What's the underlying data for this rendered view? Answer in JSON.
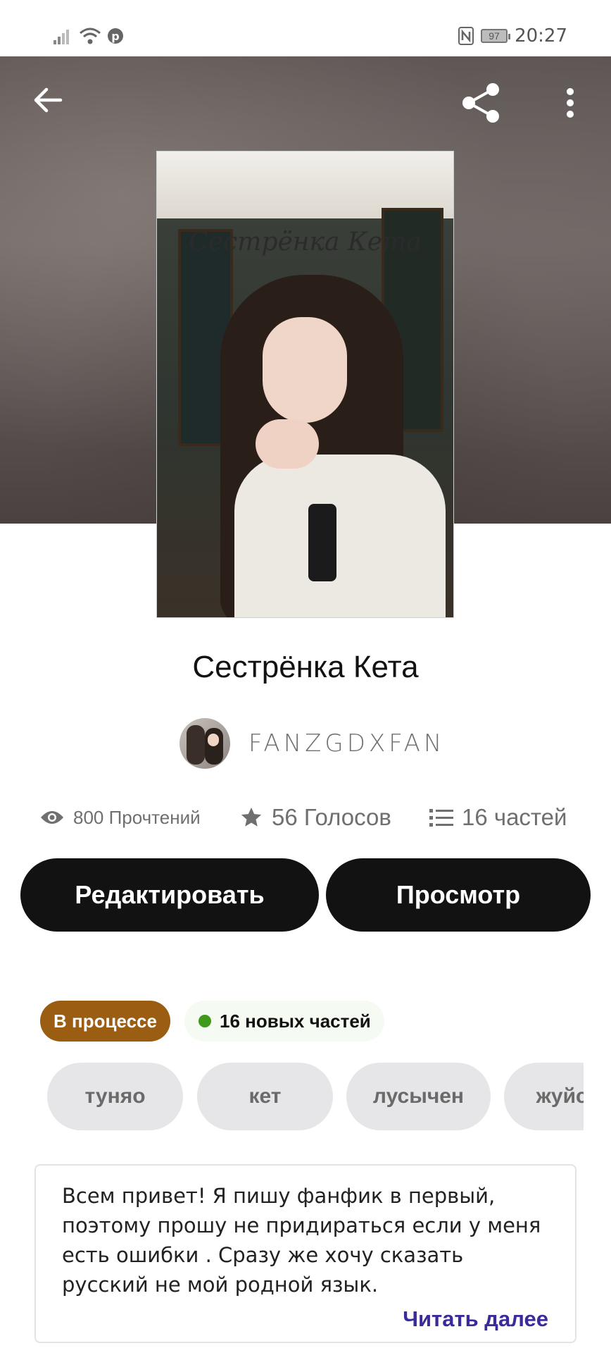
{
  "status_bar": {
    "time": "20:27",
    "battery": "97",
    "icons": [
      "signal-icon",
      "wifi-icon",
      "pinterest-icon",
      "nfc-icon",
      "battery-icon"
    ]
  },
  "toolbar": {
    "icons": [
      "back-arrow-icon",
      "share-icon",
      "more-vertical-icon"
    ]
  },
  "cover": {
    "title_text": "Сестрёнка Кета"
  },
  "story": {
    "title": "Сестрёнка Кета",
    "author": "FANZGDXFAN"
  },
  "stats": {
    "reads": "800 Прочтений",
    "votes": "56 Голосов",
    "parts": "16 частей"
  },
  "actions": {
    "edit_label": "Редактировать",
    "view_label": "Просмотр"
  },
  "badges": {
    "status": "В процессе",
    "new_parts": "16 новых частей"
  },
  "tags": [
    "туняо",
    "кет",
    "лусычен",
    "жуйсы"
  ],
  "description": {
    "text": "Всем привет! Я пишу фанфик в первый, поэтому прошу не придираться если у меня есть ошибки . Сразу же хочу сказать русский не мой родной язык.",
    "read_more": "Читать далее"
  },
  "colors": {
    "status_badge": "#9a5d12",
    "new_dot": "#3e9a18",
    "link": "#3a2b9a",
    "button": "#121212"
  }
}
